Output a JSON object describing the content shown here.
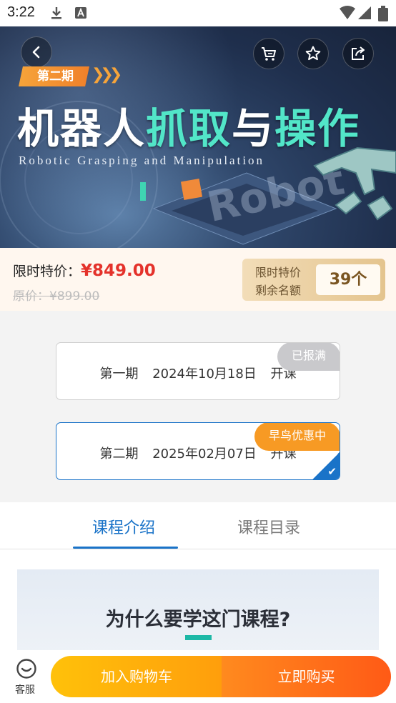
{
  "status_bar": {
    "time": "3:22"
  },
  "hero": {
    "period_tag": "第二期",
    "title_part1": "机器人",
    "title_part2": "抓取",
    "title_part3": "与",
    "title_part4": "操作",
    "subtitle": "Robotic Grasping and Manipulation",
    "watermark": "Robot",
    "icons": [
      "back-icon",
      "cart-icon",
      "star-icon",
      "share-icon"
    ]
  },
  "price": {
    "label": "限时特价：",
    "current": "¥849.00",
    "original": "原价：¥899.00",
    "quota_line1": "限时特价",
    "quota_line2": "剩余名额",
    "quota_count": "39个"
  },
  "sessions": [
    {
      "text": "第一期 2024年10月18日 开课",
      "badge": "已报满",
      "selected": false
    },
    {
      "text": "第二期 2025年02月07日 开课",
      "badge": "早鸟优惠中",
      "selected": true
    }
  ],
  "tabs": [
    {
      "label": "课程介绍",
      "active": true
    },
    {
      "label": "课程目录",
      "active": false
    }
  ],
  "content": {
    "heading": "为什么要学这门课程?"
  },
  "bottom_bar": {
    "service_label": "客服",
    "add_cart": "加入购物车",
    "buy_now": "立即购买"
  },
  "colors": {
    "accent_blue": "#1a73c8",
    "price_red": "#e4322b",
    "badge_orange": "#f79a24",
    "teal": "#1db8a6"
  }
}
